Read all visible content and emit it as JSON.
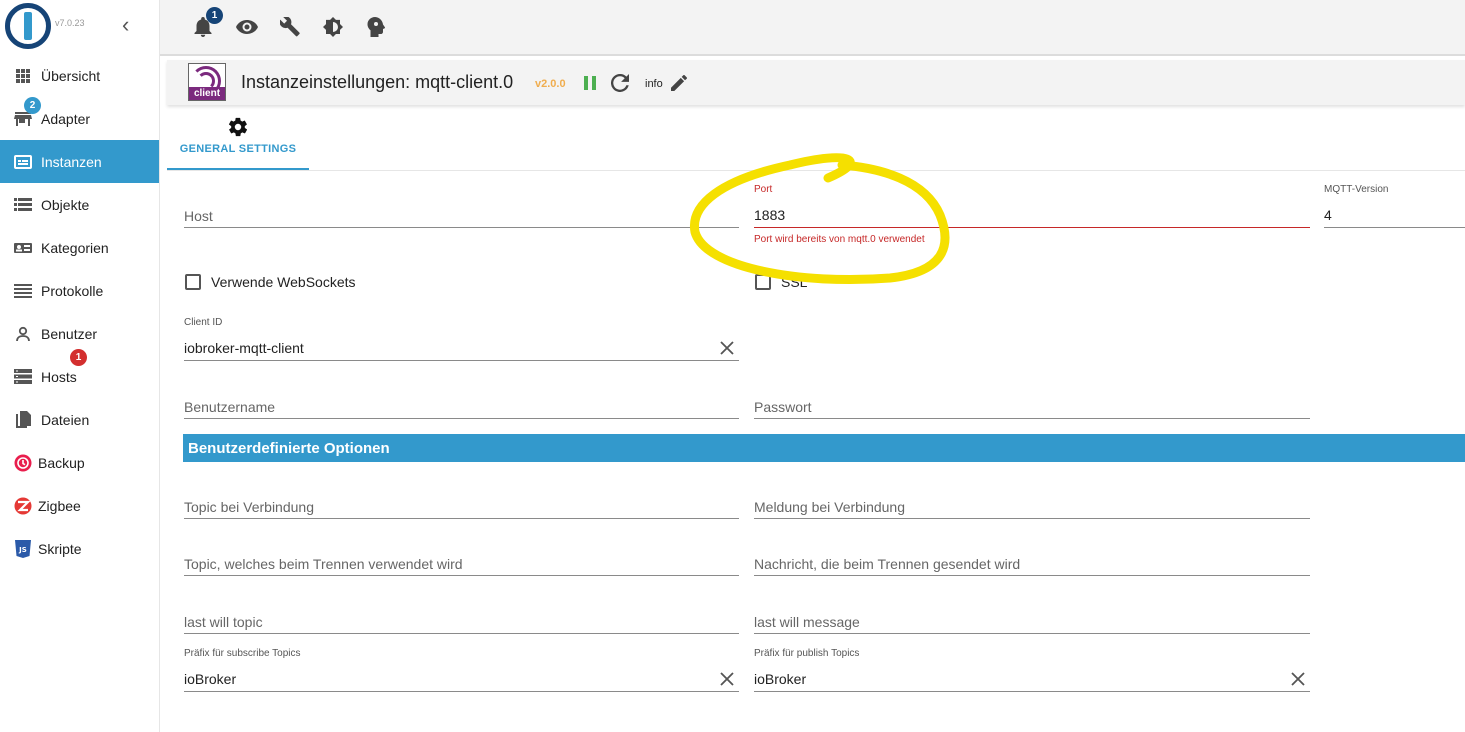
{
  "app": {
    "version": "v7.0.23"
  },
  "sidebar": {
    "items": [
      {
        "label": "Übersicht",
        "icon": "grid-icon",
        "active": false
      },
      {
        "label": "Adapter",
        "icon": "store-icon",
        "active": false,
        "badge": "2"
      },
      {
        "label": "Instanzen",
        "icon": "instances-icon",
        "active": true
      },
      {
        "label": "Objekte",
        "icon": "list-icon",
        "active": false
      },
      {
        "label": "Kategorien",
        "icon": "categories-icon",
        "active": false
      },
      {
        "label": "Protokolle",
        "icon": "logs-icon",
        "active": false
      },
      {
        "label": "Benutzer",
        "icon": "user-icon",
        "active": false
      },
      {
        "label": "Hosts",
        "icon": "hosts-icon",
        "active": false,
        "badge": "1"
      },
      {
        "label": "Dateien",
        "icon": "files-icon",
        "active": false
      },
      {
        "label": "Backup",
        "icon": "backup-icon",
        "active": false
      },
      {
        "label": "Zigbee",
        "icon": "zigbee-icon",
        "active": false
      },
      {
        "label": "Skripte",
        "icon": "javascript-icon",
        "active": false
      }
    ]
  },
  "toolbar": {
    "notifications_count": "1"
  },
  "titlebar": {
    "adapter_logo_text": "client",
    "title": "Instanzeinstellungen: mqtt-client.0",
    "version": "v2.0.0",
    "info": "info"
  },
  "tabs": [
    {
      "label": "GENERAL SETTINGS"
    }
  ],
  "form": {
    "host": {
      "placeholder": "Host"
    },
    "port": {
      "label": "Port",
      "value": "1883",
      "error": "Port wird bereits von mqtt.0 verwendet"
    },
    "mqtt_version": {
      "label": "MQTT-Version",
      "value": "4"
    },
    "websockets": {
      "label": "Verwende WebSockets"
    },
    "ssl": {
      "label": "SSL"
    },
    "client_id": {
      "label": "Client ID",
      "value": "iobroker-mqtt-client"
    },
    "username": {
      "placeholder": "Benutzername"
    },
    "password": {
      "placeholder": "Passwort"
    },
    "custom_section": "Benutzerdefinierte Optionen",
    "connect_topic": {
      "placeholder": "Topic bei Verbindung"
    },
    "connect_message": {
      "placeholder": "Meldung bei Verbindung"
    },
    "disconnect_topic": {
      "placeholder": "Topic, welches beim Trennen verwendet wird"
    },
    "disconnect_message": {
      "placeholder": "Nachricht, die beim Trennen gesendet wird"
    },
    "last_will_topic": {
      "placeholder": "last will topic"
    },
    "last_will_message": {
      "placeholder": "last will message"
    },
    "subscribe_prefix": {
      "label": "Präfix für subscribe Topics",
      "value": "ioBroker"
    },
    "publish_prefix": {
      "label": "Präfix für publish Topics",
      "value": "ioBroker"
    }
  },
  "colors": {
    "accent": "#3399CC",
    "error": "#c62828",
    "highlight": "#f5e000",
    "version": "#f0ad4e"
  }
}
